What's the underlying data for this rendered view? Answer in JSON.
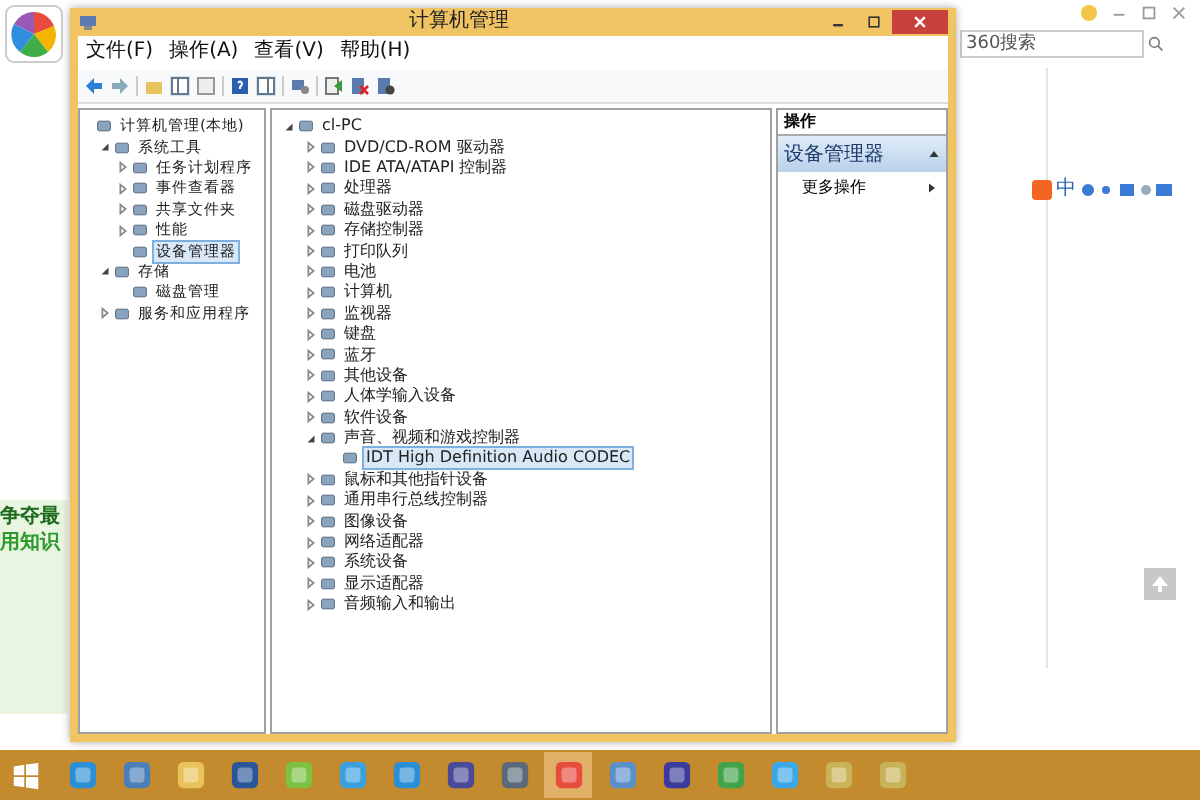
{
  "browser": {
    "search_placeholder": "360搜索",
    "ad_lines": [
      "争夺最",
      "用知识"
    ],
    "ime_label": "中"
  },
  "window": {
    "title": "计算机管理",
    "menu": [
      "文件(F)",
      "操作(A)",
      "查看(V)",
      "帮助(H)"
    ]
  },
  "tree": [
    {
      "label": "计算机管理(本地)",
      "selected": false,
      "children": [
        {
          "label": "系统工具",
          "expanded": true,
          "selected": false,
          "children": [
            {
              "label": "任务计划程序",
              "expanded": false,
              "selected": false
            },
            {
              "label": "事件查看器",
              "expanded": false,
              "selected": false
            },
            {
              "label": "共享文件夹",
              "expanded": false,
              "selected": false
            },
            {
              "label": "性能",
              "expanded": false,
              "selected": false
            },
            {
              "label": "设备管理器",
              "selected": true
            }
          ]
        },
        {
          "label": "存储",
          "expanded": true,
          "selected": false,
          "children": [
            {
              "label": "磁盘管理",
              "selected": false
            }
          ]
        },
        {
          "label": "服务和应用程序",
          "expanded": false,
          "selected": false
        }
      ]
    }
  ],
  "devices": [
    {
      "label": "cl-PC",
      "expanded": true,
      "selected": false,
      "children": [
        {
          "label": "DVD/CD-ROM 驱动器",
          "expanded": false,
          "selected": false
        },
        {
          "label": "IDE ATA/ATAPI 控制器",
          "expanded": false,
          "selected": false
        },
        {
          "label": "处理器",
          "expanded": false,
          "selected": false
        },
        {
          "label": "磁盘驱动器",
          "expanded": false,
          "selected": false
        },
        {
          "label": "存储控制器",
          "expanded": false,
          "selected": false
        },
        {
          "label": "打印队列",
          "expanded": false,
          "selected": false
        },
        {
          "label": "电池",
          "expanded": false,
          "selected": false
        },
        {
          "label": "计算机",
          "expanded": false,
          "selected": false
        },
        {
          "label": "监视器",
          "expanded": false,
          "selected": false
        },
        {
          "label": "键盘",
          "expanded": false,
          "selected": false
        },
        {
          "label": "蓝牙",
          "expanded": false,
          "selected": false
        },
        {
          "label": "其他设备",
          "expanded": false,
          "selected": false
        },
        {
          "label": "人体学输入设备",
          "expanded": false,
          "selected": false
        },
        {
          "label": "软件设备",
          "expanded": false,
          "selected": false
        },
        {
          "label": "声音、视频和游戏控制器",
          "expanded": true,
          "selected": false,
          "children": [
            {
              "label": "IDT High Definition Audio CODEC",
              "selected": true
            }
          ]
        },
        {
          "label": "鼠标和其他指针设备",
          "expanded": false,
          "selected": false
        },
        {
          "label": "通用串行总线控制器",
          "expanded": false,
          "selected": false
        },
        {
          "label": "图像设备",
          "expanded": false,
          "selected": false
        },
        {
          "label": "网络适配器",
          "expanded": false,
          "selected": false
        },
        {
          "label": "系统设备",
          "expanded": false,
          "selected": false
        },
        {
          "label": "显示适配器",
          "expanded": false,
          "selected": false
        },
        {
          "label": "音频输入和输出",
          "expanded": false,
          "selected": false
        }
      ]
    }
  ],
  "actions": {
    "header": "操作",
    "section": "设备管理器",
    "items": [
      "更多操作"
    ]
  },
  "taskbar": [
    {
      "kind": "ie",
      "selected": false
    },
    {
      "kind": "photo",
      "selected": false
    },
    {
      "kind": "folder",
      "selected": false
    },
    {
      "kind": "word",
      "selected": false
    },
    {
      "kind": "video",
      "selected": false
    },
    {
      "kind": "cloud",
      "selected": false
    },
    {
      "kind": "ie",
      "selected": false
    },
    {
      "kind": "link",
      "selected": false
    },
    {
      "kind": "camera",
      "selected": false
    },
    {
      "kind": "pinwheel",
      "selected": true
    },
    {
      "kind": "network",
      "selected": false
    },
    {
      "kind": "studio",
      "selected": false
    },
    {
      "kind": "qt",
      "selected": false
    },
    {
      "kind": "pen",
      "selected": false
    },
    {
      "kind": "shield",
      "selected": false
    },
    {
      "kind": "shield",
      "selected": false
    }
  ]
}
